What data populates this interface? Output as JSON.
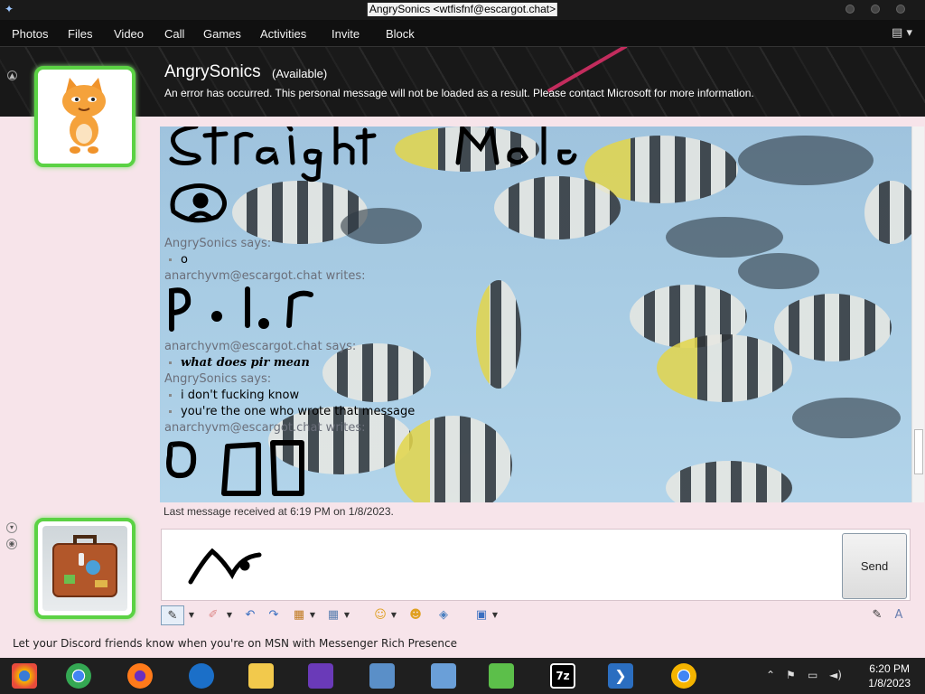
{
  "window": {
    "title": "AngrySonics <wtfisfnf@escargot.chat>"
  },
  "menu": {
    "items": [
      "Photos",
      "Files",
      "Video",
      "Call",
      "Games",
      "Activities",
      "Invite",
      "Block"
    ]
  },
  "contact": {
    "name": "AngrySonics",
    "status": "(Available)",
    "personal_message": "An error has occurred. This personal message will not be loaded as a result. Please contact Microsoft for more information."
  },
  "history": {
    "messages": [
      {
        "sender": "AngrySonics says:",
        "lines": [
          "o"
        ],
        "bold": false
      },
      {
        "sender": "anarchyvm@escargot.chat writes:",
        "lines": [],
        "ink": "handwriting"
      },
      {
        "sender": "anarchyvm@escargot.chat says:",
        "lines": [
          "what does pir mean"
        ],
        "bold": true
      },
      {
        "sender": "AngrySonics says:",
        "lines": [
          "i don't fucking know",
          "you're the one who wrote that message"
        ],
        "bold": false
      },
      {
        "sender": "anarchyvm@escargot.chat writes:",
        "lines": [],
        "ink": "handwriting"
      }
    ]
  },
  "status_line": "Last message received at 6:19 PM on 1/8/2023.",
  "compose": {
    "send_label": "Send"
  },
  "promo": "Let your Discord friends know when you're on MSN with Messenger Rich Presence",
  "taskbar": {
    "time": "6:20 PM",
    "date": "1/8/2023",
    "apps": [
      "chrome-canary-icon",
      "chrome-icon",
      "firefox-icon",
      "msn-icon",
      "file-explorer-icon",
      "visual-studio-icon",
      "remote-desktop-icon",
      "network-icon",
      "messenger-icon",
      "7zip-icon",
      "powershell-icon",
      "chrome-beta-icon"
    ]
  },
  "colors": {
    "avatar_border": "#5bd244",
    "header_bg": "#1a1a1a",
    "window_bg": "#f7e4ea"
  }
}
